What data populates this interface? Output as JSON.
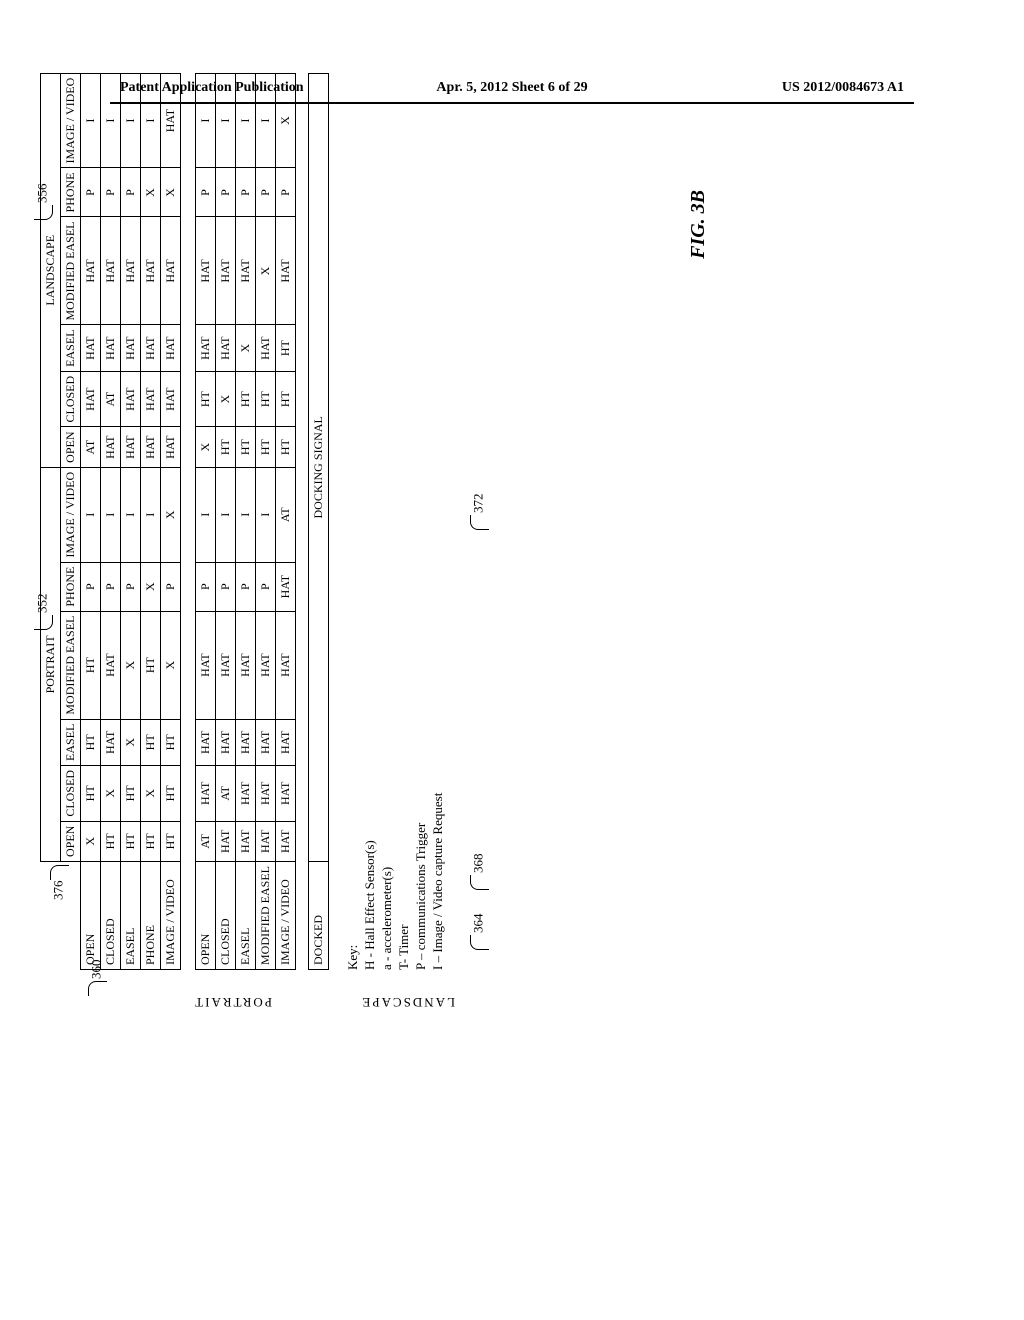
{
  "header": {
    "left": "Patent Application Publication",
    "mid": "Apr. 5, 2012  Sheet 6 of 29",
    "right": "US 2012/0084673 A1"
  },
  "group_headers": {
    "portrait": "PORTRAIT",
    "landscape": "LANDSCAPE"
  },
  "columns": [
    "OPEN",
    "CLOSED",
    "EASEL",
    "MODIFIED EASEL",
    "PHONE",
    "IMAGE / VIDEO",
    "OPEN",
    "CLOSED",
    "EASEL",
    "MODIFIED EASEL",
    "PHONE",
    "IMAGE / VIDEO"
  ],
  "vlabels": {
    "portrait": "PORTRAIT",
    "landscape": "LANDSCAPE"
  },
  "rows_portrait": [
    {
      "label": "OPEN",
      "cells": [
        "X",
        "HT",
        "HT",
        "HT",
        "P",
        "I",
        "AT",
        "HAT",
        "HAT",
        "HAT",
        "P",
        "I"
      ]
    },
    {
      "label": "CLOSED",
      "cells": [
        "HT",
        "X",
        "HAT",
        "HAT",
        "P",
        "I",
        "HAT",
        "AT",
        "HAT",
        "HAT",
        "P",
        "I"
      ]
    },
    {
      "label": "EASEL",
      "cells": [
        "HT",
        "HT",
        "X",
        "X",
        "P",
        "I",
        "HAT",
        "HAT",
        "HAT",
        "HAT",
        "P",
        "I"
      ]
    },
    {
      "label": "PHONE",
      "cells": [
        "HT",
        "X",
        "HT",
        "HT",
        "X",
        "I",
        "HAT",
        "HAT",
        "HAT",
        "HAT",
        "X",
        "I"
      ]
    },
    {
      "label": "IMAGE / VIDEO",
      "cells": [
        "HT",
        "HT",
        "HT",
        "X",
        "P",
        "X",
        "HAT",
        "HAT",
        "HAT",
        "HAT",
        "X",
        "HAT"
      ]
    }
  ],
  "rows_landscape": [
    {
      "label": "OPEN",
      "cells": [
        "AT",
        "HAT",
        "HAT",
        "HAT",
        "P",
        "I",
        "X",
        "HT",
        "HAT",
        "HAT",
        "P",
        "I"
      ]
    },
    {
      "label": "CLOSED",
      "cells": [
        "HAT",
        "AT",
        "HAT",
        "HAT",
        "P",
        "I",
        "HT",
        "X",
        "HAT",
        "HAT",
        "P",
        "I"
      ]
    },
    {
      "label": "EASEL",
      "cells": [
        "HAT",
        "HAT",
        "HAT",
        "HAT",
        "P",
        "I",
        "HT",
        "HT",
        "X",
        "HAT",
        "P",
        "I"
      ]
    },
    {
      "label": "MODIFIED EASEL",
      "cells": [
        "HAT",
        "HAT",
        "HAT",
        "HAT",
        "P",
        "I",
        "HT",
        "HT",
        "HAT",
        "X",
        "P",
        "I"
      ]
    },
    {
      "label": "IMAGE / VIDEO",
      "cells": [
        "HAT",
        "HAT",
        "HAT",
        "HAT",
        "HAT",
        "AT",
        "HT",
        "HT",
        "HT",
        "HAT",
        "P",
        "X"
      ]
    }
  ],
  "row_docked_label": "DOCKED",
  "docking_signal": "DOCKING SIGNAL",
  "callouts": {
    "c352": "352",
    "c356": "356",
    "c360": "360",
    "c364": "364",
    "c368": "368",
    "c372": "372",
    "c376": "376"
  },
  "key": {
    "title": "Key:",
    "lines": [
      "H - Hall Effect Sensor(s)",
      "a - accelerometer(s)",
      "T- Timer",
      "P – communications Trigger",
      "I – Image / Video capture Request"
    ]
  },
  "figure_caption": "FIG. 3B"
}
